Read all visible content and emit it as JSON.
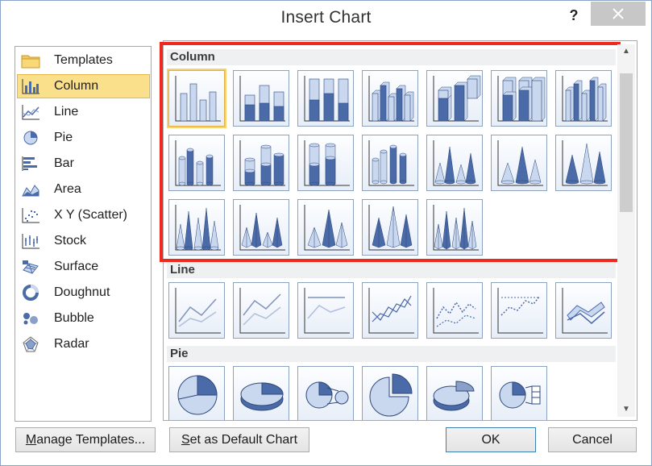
{
  "dialog": {
    "title": "Insert Chart",
    "help_label": "?",
    "close_icon": "close-icon"
  },
  "categories": [
    {
      "label": "Templates",
      "icon": "folder-icon",
      "selected": false
    },
    {
      "label": "Column",
      "icon": "column-chart-icon",
      "selected": true
    },
    {
      "label": "Line",
      "icon": "line-chart-icon",
      "selected": false
    },
    {
      "label": "Pie",
      "icon": "pie-chart-icon",
      "selected": false
    },
    {
      "label": "Bar",
      "icon": "bar-chart-icon",
      "selected": false
    },
    {
      "label": "Area",
      "icon": "area-chart-icon",
      "selected": false
    },
    {
      "label": "X Y (Scatter)",
      "icon": "scatter-chart-icon",
      "selected": false
    },
    {
      "label": "Stock",
      "icon": "stock-chart-icon",
      "selected": false
    },
    {
      "label": "Surface",
      "icon": "surface-chart-icon",
      "selected": false
    },
    {
      "label": "Doughnut",
      "icon": "doughnut-chart-icon",
      "selected": false
    },
    {
      "label": "Bubble",
      "icon": "bubble-chart-icon",
      "selected": false
    },
    {
      "label": "Radar",
      "icon": "radar-chart-icon",
      "selected": false
    }
  ],
  "gallery": {
    "sections": [
      {
        "title": "Column",
        "thumb_count": 19,
        "selected_index": 0
      },
      {
        "title": "Line",
        "thumb_count": 7
      },
      {
        "title": "Pie",
        "thumb_count": 6
      }
    ]
  },
  "buttons": {
    "manage_templates": {
      "label_underline": "M",
      "label_rest": "anage Templates..."
    },
    "set_default": {
      "label_underline": "S",
      "label_rest": "et as Default Chart"
    },
    "ok": "OK",
    "cancel": "Cancel"
  },
  "colors": {
    "selection_fill": "#fbe08c",
    "selection_border": "#e5b64b",
    "highlight_border": "#ee2a1f",
    "chart_blue": "#4a6aa8",
    "chart_light": "#c9d7ef"
  }
}
